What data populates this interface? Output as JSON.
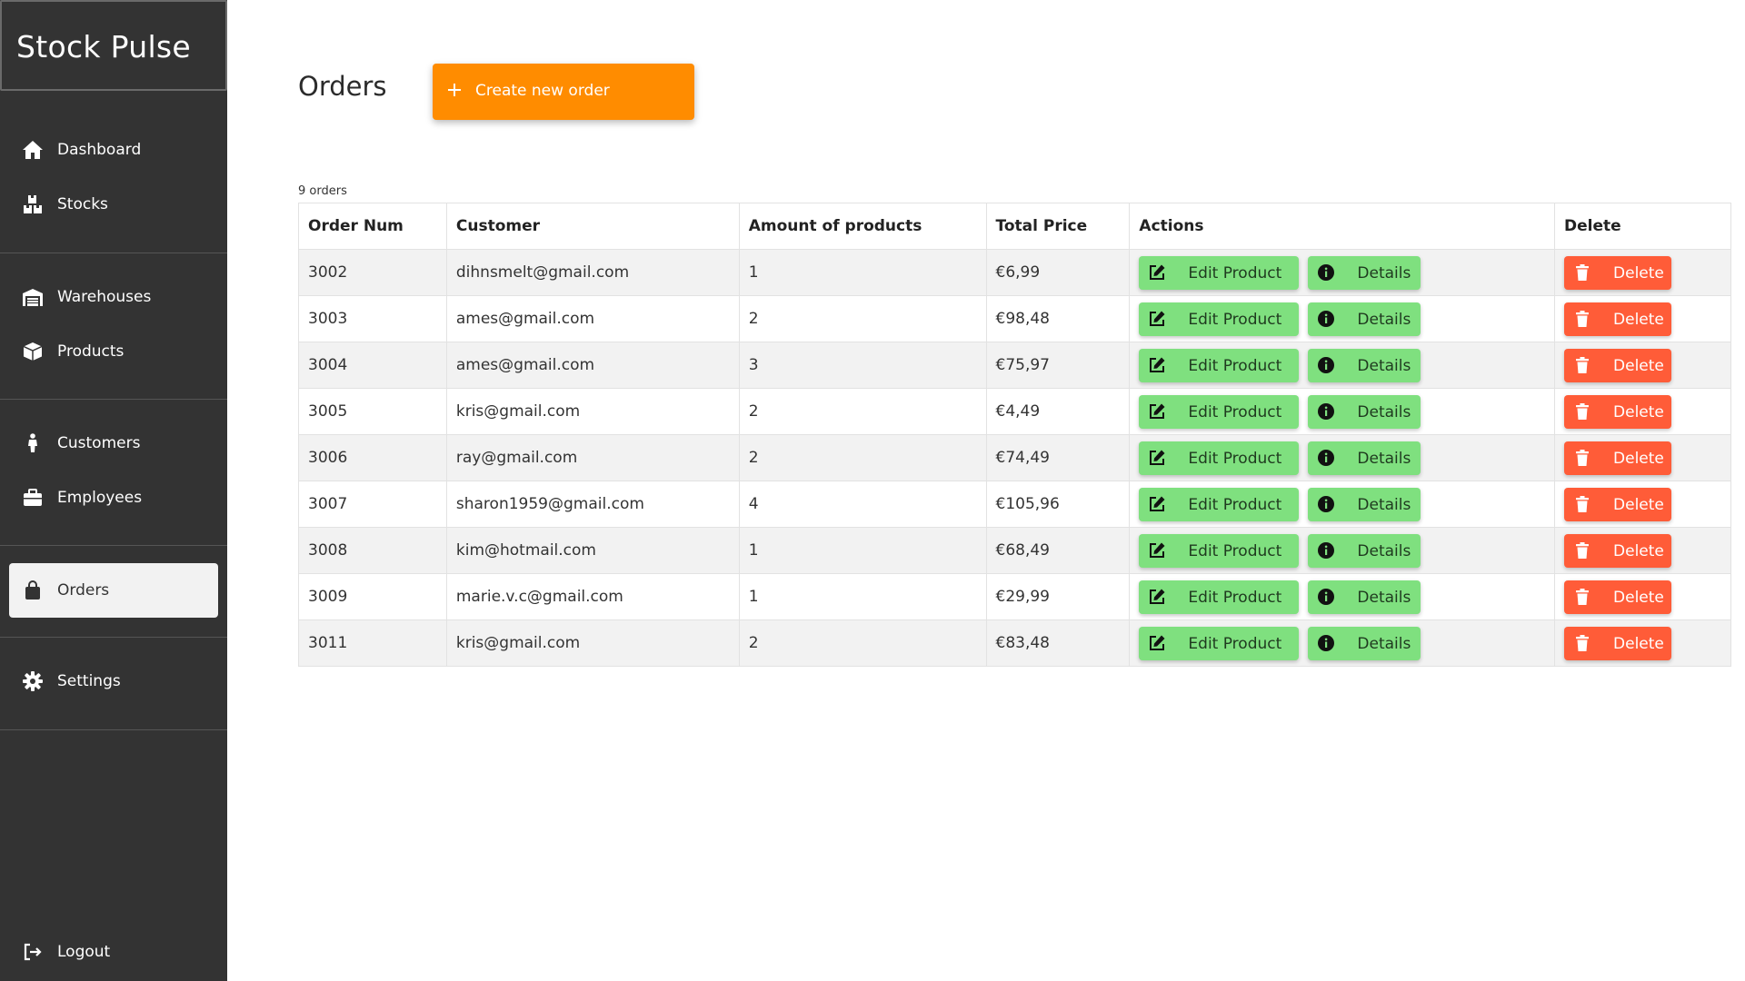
{
  "app": {
    "title": "Stock Pulse"
  },
  "nav": {
    "dashboard": "Dashboard",
    "stocks": "Stocks",
    "warehouses": "Warehouses",
    "products": "Products",
    "customers": "Customers",
    "employees": "Employees",
    "orders": "Orders",
    "settings": "Settings",
    "logout": "Logout"
  },
  "page": {
    "title": "Orders",
    "create_label": "Create new order",
    "count_text": "9 orders"
  },
  "table": {
    "headers": {
      "order_num": "Order Num",
      "customer": "Customer",
      "amount": "Amount of products",
      "total": "Total Price",
      "actions": "Actions",
      "delete": "Delete"
    },
    "button_labels": {
      "edit": "Edit Product",
      "details": "Details",
      "delete": "Delete"
    },
    "rows": [
      {
        "order_num": "3002",
        "customer": "dihnsmelt@gmail.com",
        "amount": "1",
        "total": "€6,99"
      },
      {
        "order_num": "3003",
        "customer": "ames@gmail.com",
        "amount": "2",
        "total": "€98,48"
      },
      {
        "order_num": "3004",
        "customer": "ames@gmail.com",
        "amount": "3",
        "total": "€75,97"
      },
      {
        "order_num": "3005",
        "customer": "kris@gmail.com",
        "amount": "2",
        "total": "€4,49"
      },
      {
        "order_num": "3006",
        "customer": "ray@gmail.com",
        "amount": "2",
        "total": "€74,49"
      },
      {
        "order_num": "3007",
        "customer": "sharon1959@gmail.com",
        "amount": "4",
        "total": "€105,96"
      },
      {
        "order_num": "3008",
        "customer": "kim@hotmail.com",
        "amount": "1",
        "total": "€68,49"
      },
      {
        "order_num": "3009",
        "customer": "marie.v.c@gmail.com",
        "amount": "1",
        "total": "€29,99"
      },
      {
        "order_num": "3011",
        "customer": "kris@gmail.com",
        "amount": "2",
        "total": "€83,48"
      }
    ]
  },
  "colors": {
    "sidebar_bg": "#333333",
    "accent_orange": "#ff8c00",
    "action_green": "#7fe07f",
    "delete_red": "#ff5c38"
  },
  "icons": {
    "dashboard": "home-icon",
    "stocks": "boxes-icon",
    "warehouses": "warehouse-icon",
    "products": "box-icon",
    "customers": "person-icon",
    "employees": "briefcase-icon",
    "orders": "shopping-bag-icon",
    "settings": "gear-icon",
    "logout": "logout-icon",
    "create": "plus-icon",
    "edit": "edit-icon",
    "details": "info-icon",
    "delete": "trash-icon"
  }
}
